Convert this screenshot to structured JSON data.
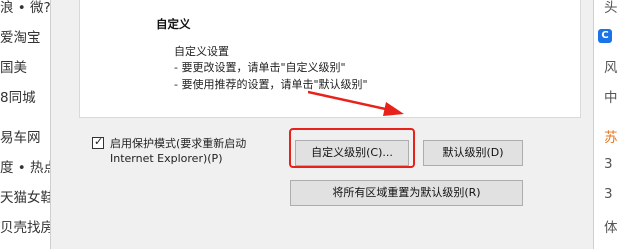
{
  "background_left": [
    "浪 • 微?",
    "爱淘宝",
    "国美",
    "8同城",
    "",
    "易车网",
    "度 • 热点",
    "天猫女鞋",
    "贝壳找房"
  ],
  "background_right": [
    "头",
    "",
    "风",
    "中",
    "",
    "苏",
    "3",
    "3",
    "体"
  ],
  "panel": {
    "heading": "自定义",
    "line1": "自定义设置",
    "line2": "- 要更改设置，请单击\"自定义级别\"",
    "line3": "- 要使用推荐的设置，请单击\"默认级别\""
  },
  "protected_mode": {
    "checked": true,
    "check_glyph": "✓",
    "label_line1": "启用保护模式(要求重新启动",
    "label_line2": "Internet Explorer)(P)"
  },
  "buttons": {
    "custom_level": "自定义级别(C)...",
    "default_level": "默认级别(D)",
    "reset_all": "将所有区域重置为默认级别(R)"
  },
  "colors": {
    "annotation_red": "#e8211b",
    "accent_blue": "#1a73e8",
    "orange_text": "#e8741a"
  }
}
